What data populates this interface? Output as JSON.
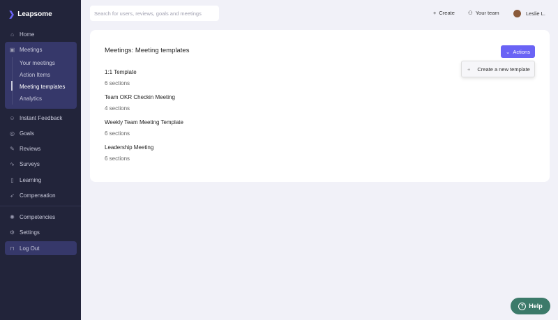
{
  "app": {
    "name": "Leapsome"
  },
  "sidebar": {
    "items": [
      {
        "label": "Home",
        "icon": "home-icon"
      },
      {
        "label": "Meetings",
        "icon": "meetings-icon"
      },
      {
        "label": "Instant Feedback",
        "icon": "feedback-icon"
      },
      {
        "label": "Goals",
        "icon": "goals-icon"
      },
      {
        "label": "Reviews",
        "icon": "reviews-icon"
      },
      {
        "label": "Surveys",
        "icon": "surveys-icon"
      },
      {
        "label": "Learning",
        "icon": "book-icon"
      },
      {
        "label": "Compensation",
        "icon": "rocket-icon"
      },
      {
        "label": "Competencies",
        "icon": "competencies-icon"
      },
      {
        "label": "Settings",
        "icon": "gear-icon"
      },
      {
        "label": "Log Out",
        "icon": "lock-icon"
      }
    ],
    "meetings_sub": [
      "Your meetings",
      "Action Items",
      "Meeting templates",
      "Analytics"
    ]
  },
  "header": {
    "search_placeholder": "Search for users, reviews, goals and meetings",
    "create": "Create",
    "team": "Your team",
    "user": "Leslie L."
  },
  "main": {
    "title": "Meetings: Meeting templates",
    "actions": "Actions",
    "menu_item": "Create a new template",
    "templates": [
      {
        "name": "1:1 Template",
        "sections": "6 sections"
      },
      {
        "name": "Team OKR Checkin Meeting",
        "sections": "4 sections"
      },
      {
        "name": "Weekly Team Meeting Template",
        "sections": "6 sections"
      },
      {
        "name": "Leadership Meeting",
        "sections": "6 sections"
      }
    ]
  },
  "help": "Help"
}
